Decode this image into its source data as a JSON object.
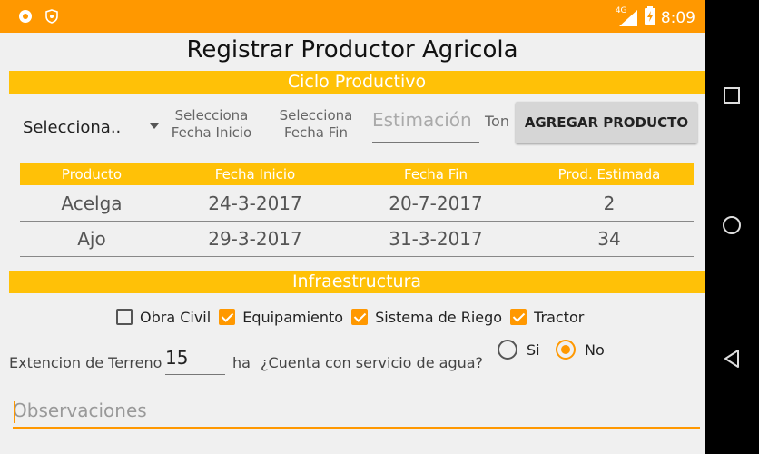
{
  "status_bar": {
    "network": "4G",
    "time": "8:09"
  },
  "title": "Registrar Productor Agricola",
  "ciclo": {
    "header": "Ciclo Productivo",
    "spinner": "Selecciona..",
    "fecha_inicio_btn": "Selecciona\nFecha Inicio",
    "fecha_fin_btn": "Selecciona\nFecha Fin",
    "estimacion_placeholder": "Estimación",
    "unit": "Ton",
    "add_button": "AGREGAR PRODUCTO"
  },
  "table": {
    "columns": [
      "Producto",
      "Fecha Inicio",
      "Fecha Fin",
      "Prod. Estimada"
    ],
    "rows": [
      [
        "Acelga",
        "24-3-2017",
        "20-7-2017",
        "2"
      ],
      [
        "Ajo",
        "29-3-2017",
        "31-3-2017",
        "34"
      ]
    ]
  },
  "infra": {
    "header": "Infraestructura",
    "checkboxes": [
      {
        "label": "Obra Civil",
        "checked": false
      },
      {
        "label": "Equipamiento",
        "checked": true
      },
      {
        "label": "Sistema de Riego",
        "checked": true
      },
      {
        "label": "Tractor",
        "checked": true
      }
    ],
    "extension_label": "Extencion de Terreno",
    "extension_value": "15",
    "extension_unit": "ha",
    "agua_question": "¿Cuenta con servicio de agua?",
    "radio_si": "Si",
    "radio_no": "No",
    "agua_selected": "No"
  },
  "observaciones_placeholder": "Observaciones",
  "colors": {
    "accent": "#ff9800",
    "section": "#ffc107"
  },
  "icons": [
    "circle-notification-icon",
    "shield-icon",
    "signal-4g-icon",
    "battery-icon",
    "recent-apps-icon",
    "home-icon",
    "back-icon"
  ]
}
